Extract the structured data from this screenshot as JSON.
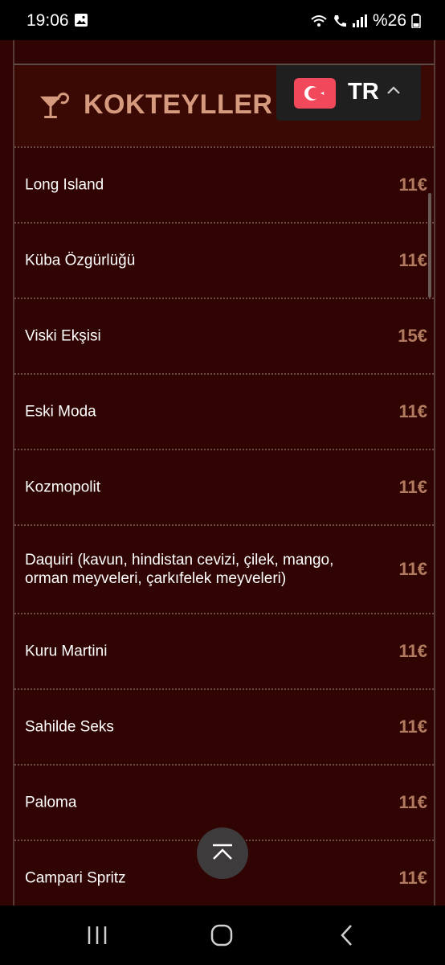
{
  "status_bar": {
    "time": "19:06",
    "battery": "%26",
    "icons": [
      "gallery-icon",
      "wifi-call-icon",
      "phone-wifi-icon",
      "signal-icon",
      "battery-icon"
    ]
  },
  "language": {
    "code": "TR",
    "flag": "turkey-flag-icon",
    "flag_color": "#f2485c"
  },
  "section": {
    "title": "KOKTEYLLER",
    "icon": "cocktail-glass-icon",
    "accent_color": "#d69a7e"
  },
  "items": [
    {
      "name": "Long Island",
      "price": "11€"
    },
    {
      "name": "Küba Özgürlüğü",
      "price": "11€"
    },
    {
      "name": "Viski Ekşisi",
      "price": "15€"
    },
    {
      "name": "Eski Moda",
      "price": "11€"
    },
    {
      "name": "Kozmopolit",
      "price": "11€"
    },
    {
      "name": "Daquiri (kavun, hindistan cevizi, çilek, mango, orman meyveleri, çarkıfelek meyveleri)",
      "price": "11€"
    },
    {
      "name": "Kuru Martini",
      "price": "11€"
    },
    {
      "name": "Sahilde Seks",
      "price": "11€"
    },
    {
      "name": "Paloma",
      "price": "11€"
    },
    {
      "name": "Campari Spritz",
      "price": "11€"
    }
  ],
  "colors": {
    "background": "#2f0402",
    "price": "#b27b60",
    "item_text": "#ffffff"
  },
  "navigation": {
    "icons": [
      "recent-apps-icon",
      "home-icon",
      "back-icon"
    ]
  }
}
